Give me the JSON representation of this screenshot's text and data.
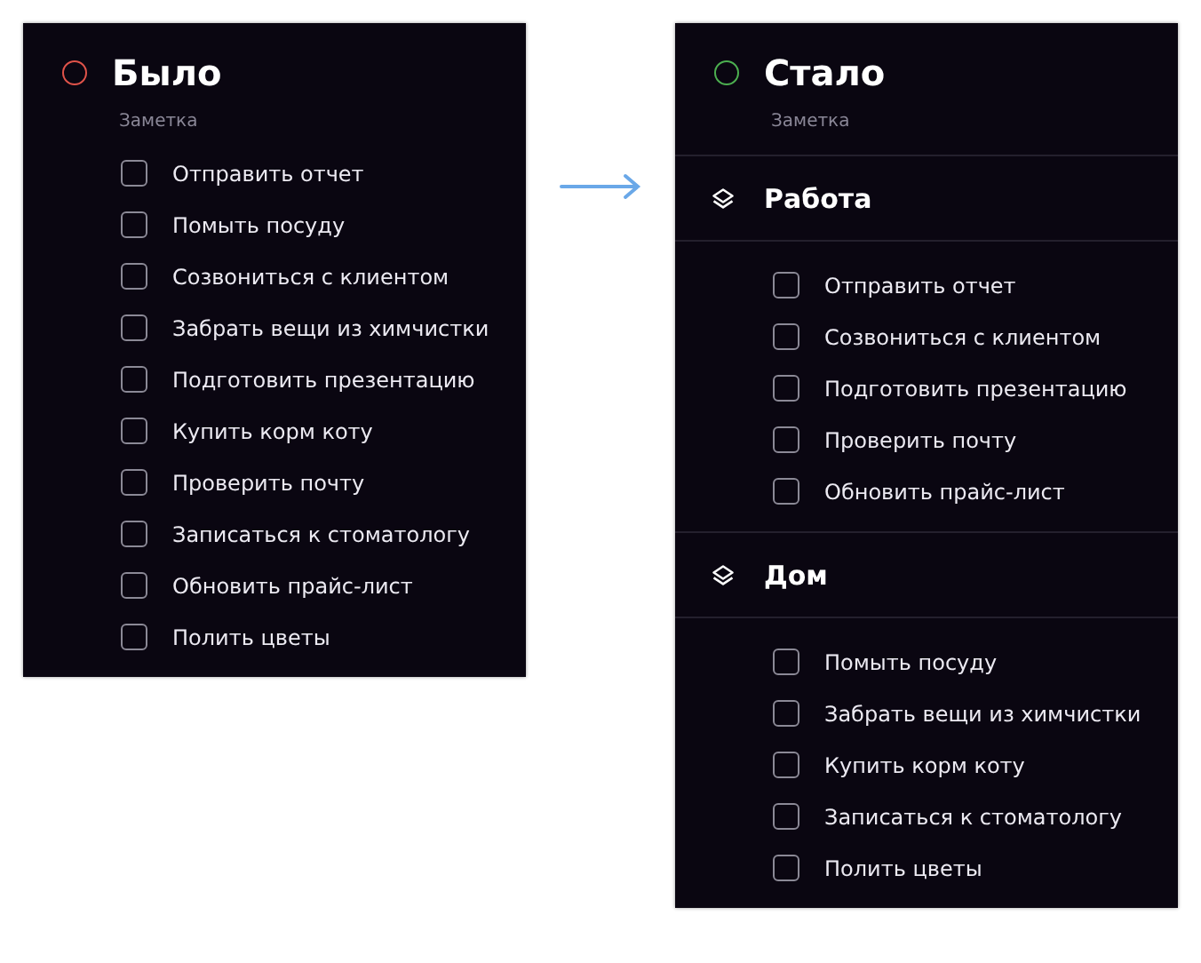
{
  "cards": [
    {
      "title": "Было",
      "subtitle": "Заметка",
      "color": "#e0534a",
      "tasks": [
        {
          "label": "Отправить отчет",
          "checked": false
        },
        {
          "label": "Помыть посуду",
          "checked": false
        },
        {
          "label": "Созвониться с клиентом",
          "checked": false
        },
        {
          "label": "Забрать вещи из химчистки",
          "checked": false
        },
        {
          "label": "Подготовить презентацию",
          "checked": false
        },
        {
          "label": "Купить корм коту",
          "checked": false
        },
        {
          "label": "Проверить почту",
          "checked": false
        },
        {
          "label": "Записаться к стоматологу",
          "checked": false
        },
        {
          "label": "Обновить прайс-лист",
          "checked": false
        },
        {
          "label": "Полить цветы",
          "checked": false
        }
      ]
    },
    {
      "title": "Стало",
      "subtitle": "Заметка",
      "color": "#4caf50",
      "sections": [
        {
          "title": "Работа",
          "tasks": [
            {
              "label": "Отправить отчет",
              "checked": false
            },
            {
              "label": "Созвониться с клиентом",
              "checked": false
            },
            {
              "label": "Подготовить презентацию",
              "checked": false
            },
            {
              "label": "Проверить почту",
              "checked": false
            },
            {
              "label": "Обновить прайс-лист",
              "checked": false
            }
          ]
        },
        {
          "title": "Дом",
          "tasks": [
            {
              "label": "Помыть посуду",
              "checked": false
            },
            {
              "label": "Забрать вещи из химчистки",
              "checked": false
            },
            {
              "label": "Купить корм коту",
              "checked": false
            },
            {
              "label": "Записаться к стоматологу",
              "checked": false
            },
            {
              "label": "Полить цветы",
              "checked": false
            }
          ]
        }
      ]
    }
  ]
}
